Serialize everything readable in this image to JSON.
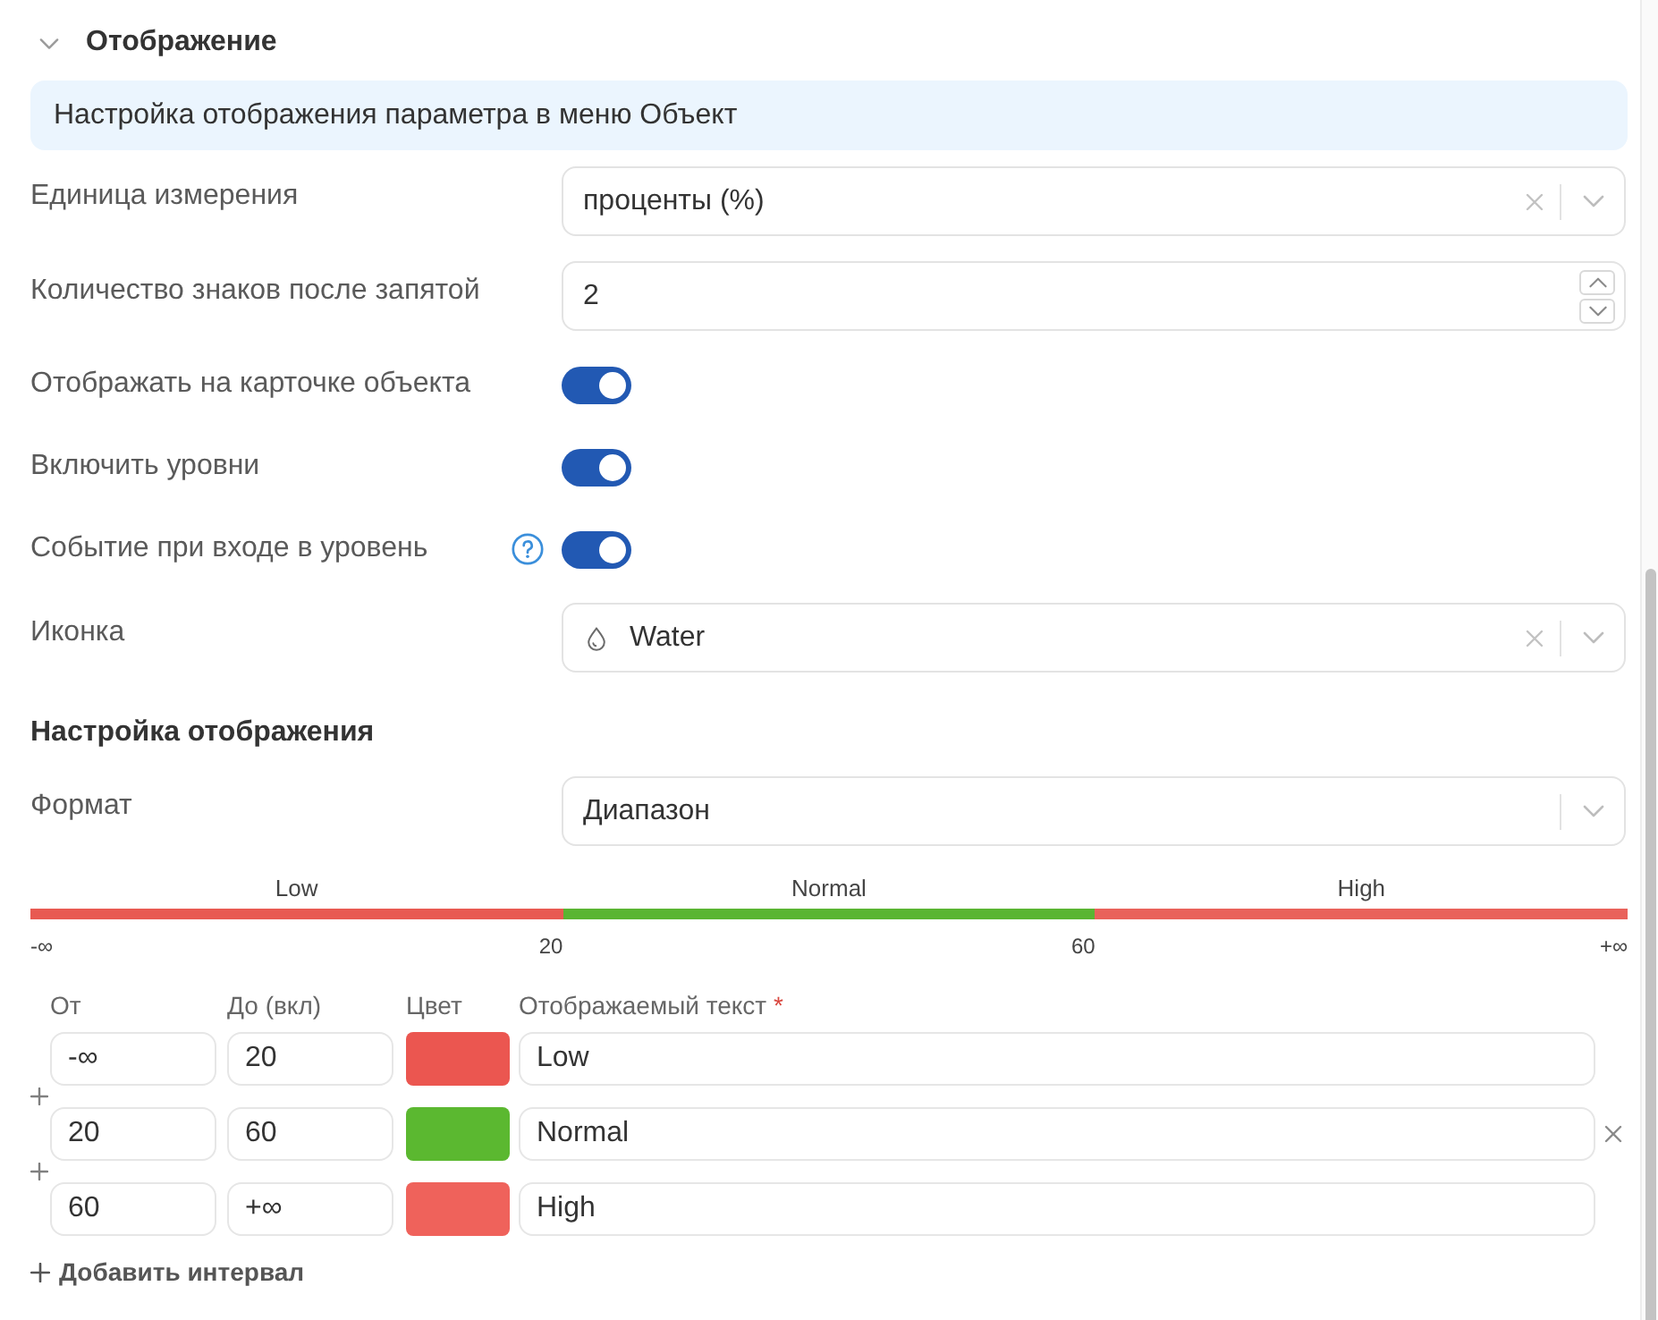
{
  "section": {
    "title": "Отображение",
    "expanded": true
  },
  "info_banner": {
    "text": "Настройка отображения параметра в меню Объект"
  },
  "fields": [
    {
      "kind": "select",
      "label": "Единица измерения",
      "value": "проценты (%)",
      "clearable": true,
      "help": false
    },
    {
      "kind": "number",
      "label": "Количество знаков после запятой",
      "value": "2",
      "help": false
    },
    {
      "kind": "toggle",
      "label": "Отображать на карточке объекта",
      "on": true,
      "help": false
    },
    {
      "kind": "toggle",
      "label": "Включить уровни",
      "on": true,
      "help": false
    },
    {
      "kind": "toggle",
      "label": "Событие при входе в уровень",
      "on": true,
      "help": true
    },
    {
      "kind": "icon-select",
      "label": "Иконка",
      "value": "Water",
      "clearable": true,
      "help": false
    }
  ],
  "display_settings": {
    "title": "Настройка отображения",
    "format": {
      "label": "Формат",
      "value": "Диапазон",
      "clearable": false
    },
    "scale": {
      "segments": [
        {
          "label": "Low",
          "color": "#e85a52"
        },
        {
          "label": "Normal",
          "color": "#5ab532"
        },
        {
          "label": "High",
          "color": "#e9625b"
        }
      ],
      "ticks": [
        "-∞",
        "20",
        "60",
        "+∞"
      ]
    },
    "intervals": {
      "columns": [
        {
          "label": "От",
          "required": false
        },
        {
          "label": "До (вкл)",
          "required": false
        },
        {
          "label": "Цвет",
          "required": false
        },
        {
          "label": "Отображаемый текст",
          "required": true
        }
      ],
      "required_mark": "*",
      "rows": [
        {
          "from": "-∞",
          "to": "20",
          "color": "#eb5650",
          "text": "Low",
          "remove_visible": false
        },
        {
          "from": "20",
          "to": "60",
          "color": "#5bb830",
          "text": "Normal",
          "remove_visible": true
        },
        {
          "from": "60",
          "to": "+∞",
          "color": "#ef625b",
          "text": "High",
          "remove_visible": false
        }
      ],
      "add_button": "Добавить интервал"
    }
  }
}
